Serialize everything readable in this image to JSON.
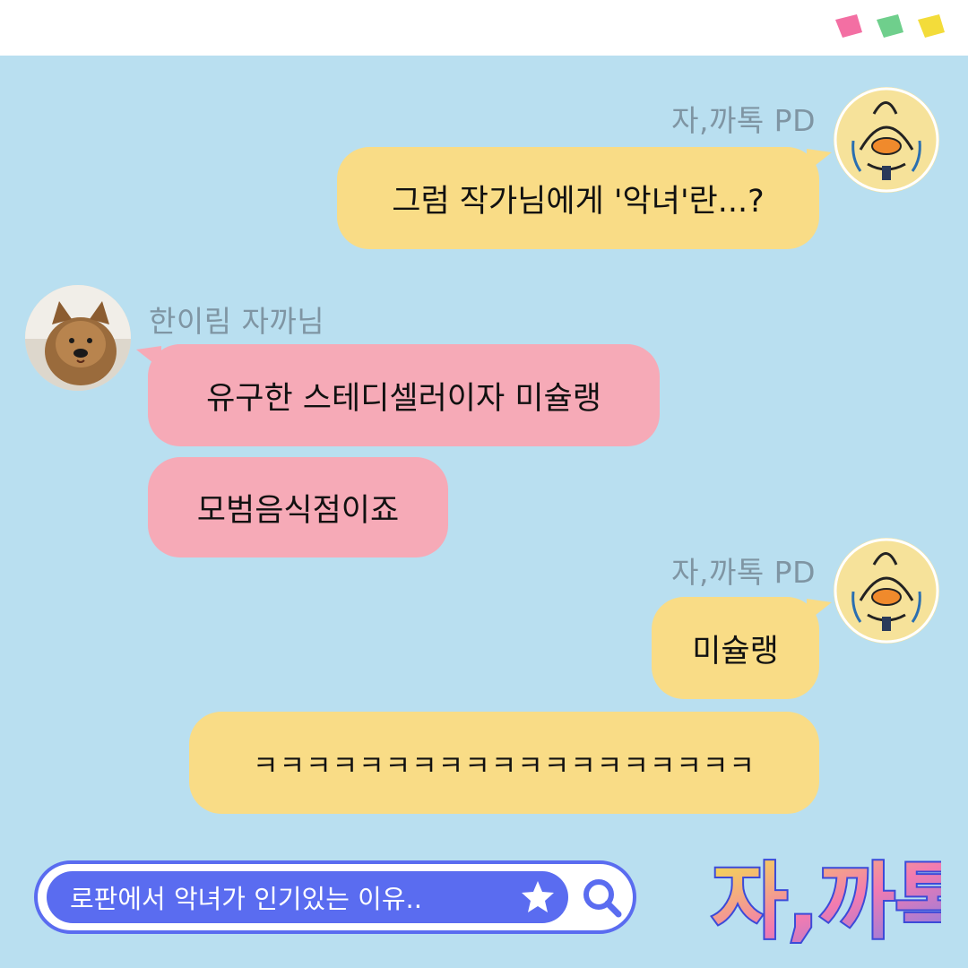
{
  "messages": [
    {
      "sender": "자,까톡 PD",
      "text": "그럼 작가님에게 '악녀'란...?"
    },
    {
      "sender": "한이림 자까님",
      "text": "유구한 스테디셀러이자 미슐랭"
    },
    {
      "text": "모범음식점이죠"
    },
    {
      "sender": "자,까톡 PD",
      "text": "미슐랭"
    },
    {
      "text": "ㅋㅋㅋㅋㅋㅋㅋㅋㅋㅋㅋㅋㅋㅋㅋㅋㅋㅋㅋ"
    }
  ],
  "search": {
    "query": "로판에서 악녀가 인기있는 이유..",
    "icon": "search-icon"
  },
  "logo": {
    "text": "자,까톡"
  },
  "colors": {
    "background": "#b9dff0",
    "my_bubble": "#f9dc86",
    "their_bubble": "#f6aab7",
    "sender_text": "#7f95a3",
    "accent": "#5a6cf0",
    "flag_pink": "#f36fa3",
    "flag_green": "#6fcf8c",
    "flag_yellow": "#f3dc3a"
  }
}
